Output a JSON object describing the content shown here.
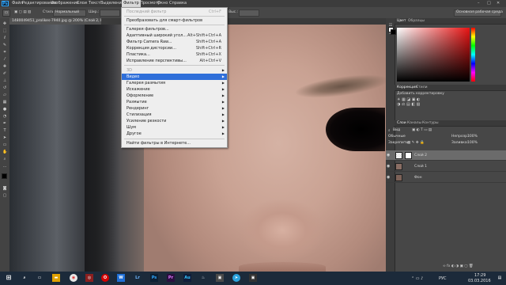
{
  "menubar": {
    "app_icon": "Ps",
    "items": [
      "Файл",
      "Редактирование",
      "Изображение",
      "Слои",
      "Текст",
      "Выделение",
      "Фильтр",
      "Просмотр",
      "Окно",
      "Справка"
    ]
  },
  "options": {
    "style_label": "Стиль:",
    "style_value": "Нормальный",
    "width_label": "Шир.:",
    "height_label": "Выс.:",
    "workspace_value": "Основная рабочая среда"
  },
  "document_tab": {
    "title": "1480049451_prolikes-7940.jpg @ 200% (Слой 2, RGB/8#)"
  },
  "filter_menu": {
    "items": [
      {
        "label": "Последний фильтр",
        "shortcut": "Ctrl+F",
        "disabled": true
      },
      {
        "label": "Преобразовать для смарт-фильтров"
      },
      {
        "label": "Галерея фильтров..."
      },
      {
        "label": "Адаптивный широкий угол...",
        "shortcut": "Alt+Shift+Ctrl+A"
      },
      {
        "label": "Фильтр Camera Raw...",
        "shortcut": "Shift+Ctrl+A"
      },
      {
        "label": "Коррекция дисторсии...",
        "shortcut": "Shift+Ctrl+R"
      },
      {
        "label": "Пластика...",
        "shortcut": "Shift+Ctrl+X"
      },
      {
        "label": "Исправление перспективы...",
        "shortcut": "Alt+Ctrl+V"
      },
      {
        "label": "3D",
        "submenu": true,
        "disabled": true
      },
      {
        "label": "Видео",
        "submenu": true,
        "highlighted": true
      },
      {
        "label": "Галерея размытия",
        "submenu": true
      },
      {
        "label": "Искажение",
        "submenu": true
      },
      {
        "label": "Оформление",
        "submenu": true
      },
      {
        "label": "Размытие",
        "submenu": true
      },
      {
        "label": "Рендеринг",
        "submenu": true
      },
      {
        "label": "Стилизация",
        "submenu": true
      },
      {
        "label": "Усиление резкости",
        "submenu": true
      },
      {
        "label": "Шум",
        "submenu": true
      },
      {
        "label": "Другое",
        "submenu": true
      },
      {
        "label": "Найти фильтры в Интернете..."
      }
    ]
  },
  "color_panel": {
    "tabs": [
      "Цвет",
      "Образцы"
    ],
    "fg_color": "#ffffff",
    "bg_color": "#000000"
  },
  "adjustments_panel": {
    "tabs": [
      "Коррекция",
      "Стили"
    ],
    "hint": "Добавить корректировку"
  },
  "layers_panel": {
    "tabs": [
      "Слои",
      "Каналы",
      "Контуры"
    ],
    "kind_label": "Вид",
    "blend_mode": "Обычные",
    "opacity_label": "Непрозр.:",
    "opacity_value": "100%",
    "lock_label": "Закрепить:",
    "fill_label": "Заливка:",
    "fill_value": "100%",
    "layers": [
      {
        "name": "Слой 2",
        "selected": true
      },
      {
        "name": "Слой 1"
      },
      {
        "name": "Фон"
      }
    ]
  },
  "taskbar": {
    "lang": "РУС",
    "time": "17:29",
    "date": "03.03.2016"
  },
  "icons": {
    "start": "windows-icon",
    "search": "search-icon"
  }
}
